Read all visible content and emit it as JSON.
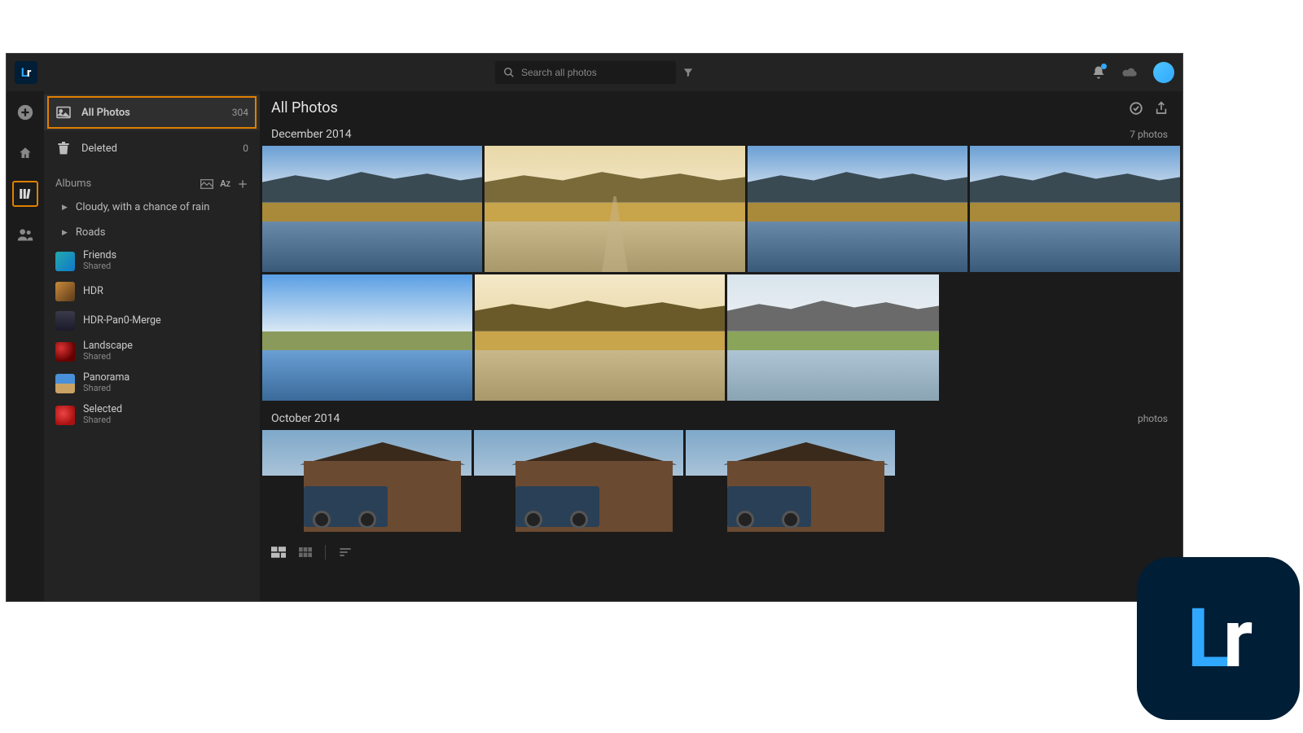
{
  "app": {
    "logo_initials": "Lr"
  },
  "search": {
    "placeholder": "Search all photos"
  },
  "sidebar": {
    "all_photos": {
      "label": "All Photos",
      "count": "304"
    },
    "deleted": {
      "label": "Deleted",
      "count": "0"
    },
    "albums_header": "Albums",
    "folders": [
      {
        "label": "Cloudy, with a chance of rain"
      },
      {
        "label": "Roads"
      }
    ],
    "albums": [
      {
        "name": "Friends",
        "meta": "Shared",
        "thumb": "g-friends"
      },
      {
        "name": "HDR",
        "meta": "",
        "thumb": "g-hdr"
      },
      {
        "name": "HDR-Pan0-Merge",
        "meta": "",
        "thumb": "g-hdrp"
      },
      {
        "name": "Landscape",
        "meta": "Shared",
        "thumb": "g-land"
      },
      {
        "name": "Panorama",
        "meta": "Shared",
        "thumb": "g-pano"
      },
      {
        "name": "Selected",
        "meta": "Shared",
        "thumb": "g-sel"
      }
    ]
  },
  "main": {
    "title": "All Photos",
    "sections": [
      {
        "label": "December 2014",
        "count": "7 photos"
      },
      {
        "label": "October 2014",
        "count": "photos"
      }
    ]
  },
  "thumbs": {
    "dec": [
      {
        "w": "w270",
        "sky": "linear-gradient(#6a9fd4,#e8eef4)",
        "mtn": "#3a4a52",
        "land": "#a88a3a",
        "water": "linear-gradient(#6a8aaa,#3a5a7a)"
      },
      {
        "w": "w320",
        "sky": "linear-gradient(#e8d8a8,#f4e8c8)",
        "mtn": "#7a6a3a",
        "land": "#c8a44a",
        "water": "linear-gradient(#c8b88a,#a8986a)",
        "road": true
      },
      {
        "w": "w270",
        "sky": "linear-gradient(#6a9fd4,#e8eef4)",
        "mtn": "#3a4a52",
        "land": "#a88a3a",
        "water": "linear-gradient(#6a8aaa,#3a5a7a)"
      },
      {
        "w": "w258",
        "sky": "linear-gradient(#6a9fd4,#e8eef4)",
        "mtn": "#3a4a52",
        "land": "#a88a3a",
        "water": "linear-gradient(#6a8aaa,#3a5a7a)"
      },
      {
        "w": "w258",
        "sky": "linear-gradient(#5a9fe4,#d8e8f4)",
        "mtn": "rgba(255,255,255,0)",
        "land": "#8a9a5a",
        "water": "linear-gradient(#6a9fd4,#3a6a9a)"
      },
      {
        "w": "w307",
        "sky": "linear-gradient(#f4e8c8,#e8d8a8)",
        "mtn": "#6a5a2a",
        "land": "#c8a44a",
        "water": "linear-gradient(#c8b88a,#a8986a)"
      },
      {
        "w": "w260",
        "sky": "linear-gradient(#d8e4ec,#eef2f6)",
        "mtn": "#6a6a6a",
        "land": "#8aa45a",
        "water": "linear-gradient(#aec4d4,#8aa4b4)"
      }
    ]
  }
}
